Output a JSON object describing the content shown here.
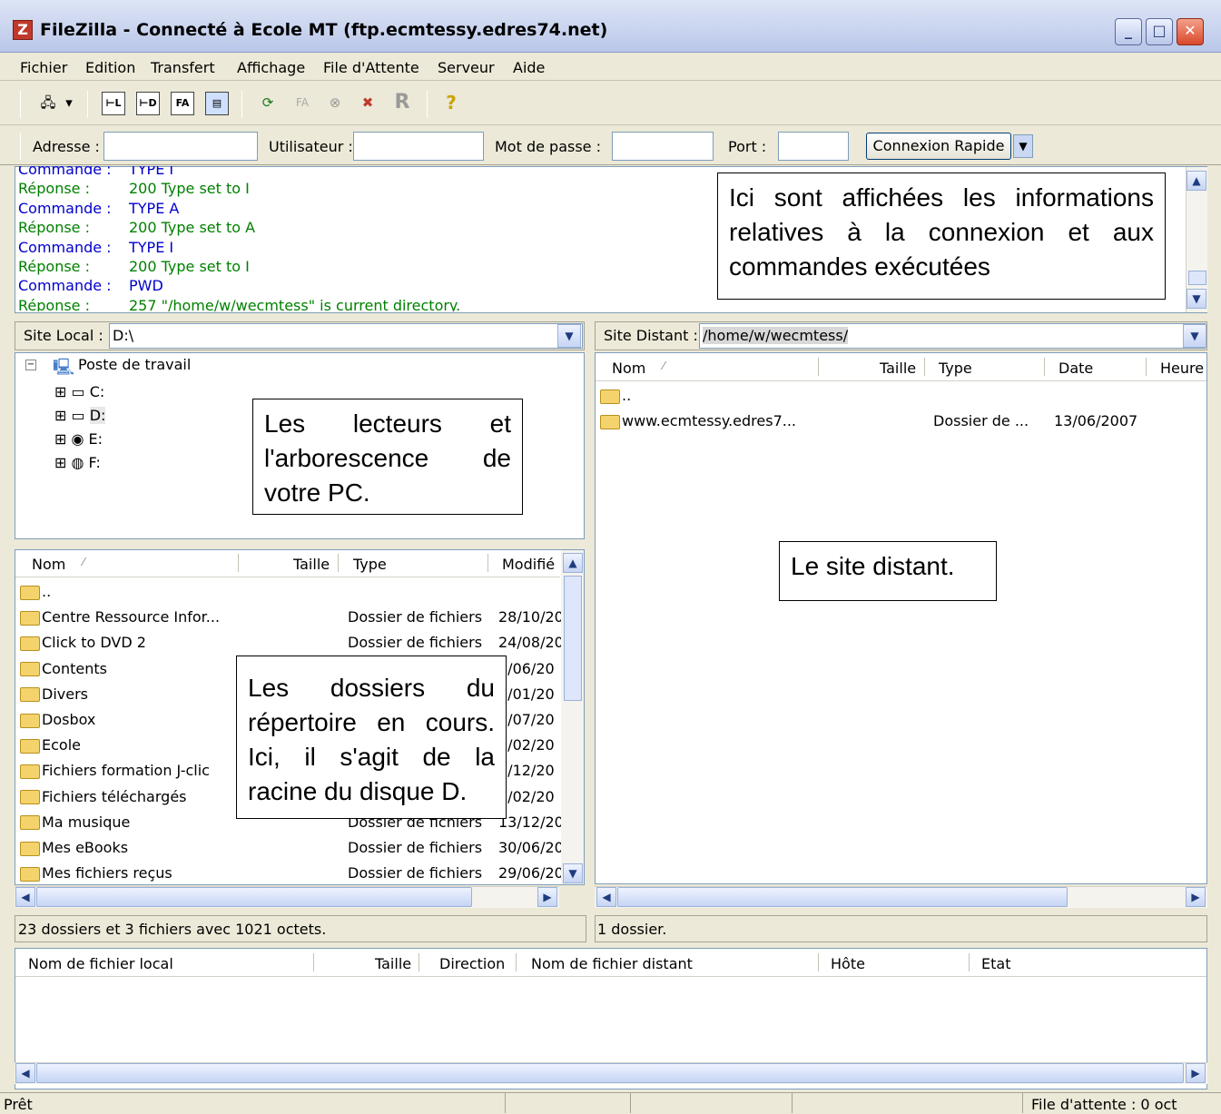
{
  "window": {
    "title": "FileZilla - Connecté à Ecole MT (ftp.ecmtessy.edres74.net)",
    "app_icon": "Z"
  },
  "menu": [
    "Fichier",
    "Edition",
    "Transfert",
    "Affichage",
    "File d'Attente",
    "Serveur",
    "Aide"
  ],
  "toolbar": {
    "fa_label": "FA",
    "fa2_label": "FA",
    "r_label": "R",
    "help_label": "?"
  },
  "quickconnect": {
    "host_label": "Adresse :",
    "user_label": "Utilisateur :",
    "pass_label": "Mot de passe :",
    "port_label": "Port :",
    "connect_label": "Connexion Rapide",
    "host_value": "",
    "user_value": "",
    "pass_value": "",
    "port_value": ""
  },
  "log": [
    {
      "k": "Commande :",
      "v": "TYPE I",
      "color": "#0000cc"
    },
    {
      "k": "Réponse :",
      "v": "200 Type set to I",
      "color": "#008000"
    },
    {
      "k": "Commande :",
      "v": "TYPE A",
      "color": "#0000cc"
    },
    {
      "k": "Réponse :",
      "v": "200 Type set to A",
      "color": "#008000"
    },
    {
      "k": "Commande :",
      "v": "TYPE I",
      "color": "#0000cc"
    },
    {
      "k": "Réponse :",
      "v": "200 Type set to I",
      "color": "#008000"
    },
    {
      "k": "Commande :",
      "v": "PWD",
      "color": "#0000cc"
    },
    {
      "k": "Réponse :",
      "v": "257 \"/home/w/wecmtess\" is current directory.",
      "color": "#008000"
    }
  ],
  "callouts": {
    "log": "Ici sont affichées les informations relatives à la connexion et aux commandes exécutées",
    "tree": "Les lecteurs et l'arborescence de votre PC.",
    "local_files": "Les dossiers du répertoire en cours. Ici, il s'agit de la racine du disque D.",
    "remote": "Le site distant."
  },
  "local": {
    "path_label": "Site Local :",
    "path": "D:\\",
    "tree_root": "Poste de travail",
    "drives": [
      "C:",
      "D:",
      "E:",
      "F:"
    ],
    "columns": [
      "Nom",
      "Taille",
      "Type",
      "Modifié"
    ],
    "rows": [
      {
        "name": "..",
        "type": "",
        "date": ""
      },
      {
        "name": "Centre Ressource Infor...",
        "type": "Dossier de fichiers",
        "date": "28/10/20"
      },
      {
        "name": "Click to DVD 2",
        "type": "Dossier de fichiers",
        "date": "24/08/20"
      },
      {
        "name": "Contents",
        "type": "",
        "date": "6/06/20"
      },
      {
        "name": "Divers",
        "type": "",
        "date": "3/01/20"
      },
      {
        "name": "Dosbox",
        "type": "",
        "date": "1/07/20"
      },
      {
        "name": "Ecole",
        "type": "",
        "date": "1/02/20"
      },
      {
        "name": "Fichiers formation J-clic",
        "type": "",
        "date": "1/12/20"
      },
      {
        "name": "Fichiers téléchargés",
        "type": "",
        "date": "5/02/20"
      },
      {
        "name": "Ma musique",
        "type": "Dossier de fichiers",
        "date": "13/12/20"
      },
      {
        "name": "Mes eBooks",
        "type": "Dossier de fichiers",
        "date": "30/06/20"
      },
      {
        "name": "Mes fichiers reçus",
        "type": "Dossier de fichiers",
        "date": "29/06/20"
      }
    ],
    "status": "23 dossiers et 3 fichiers avec 1021 octets."
  },
  "remote": {
    "path_label": "Site Distant :",
    "path": "/home/w/wecmtess/",
    "columns": [
      "Nom",
      "Taille",
      "Type",
      "Date",
      "Heure"
    ],
    "rows": [
      {
        "name": "..",
        "type": "",
        "date": ""
      },
      {
        "name": "www.ecmtessy.edres7...",
        "type": "Dossier de ...",
        "date": "13/06/2007"
      }
    ],
    "status": "1 dossier."
  },
  "queue": {
    "columns": [
      "Nom de fichier local",
      "Taille",
      "Direction",
      "Nom de fichier distant",
      "Hôte",
      "Etat"
    ]
  },
  "statusbar": {
    "left": "Prêt",
    "right": "File d'attente : 0 oct"
  }
}
